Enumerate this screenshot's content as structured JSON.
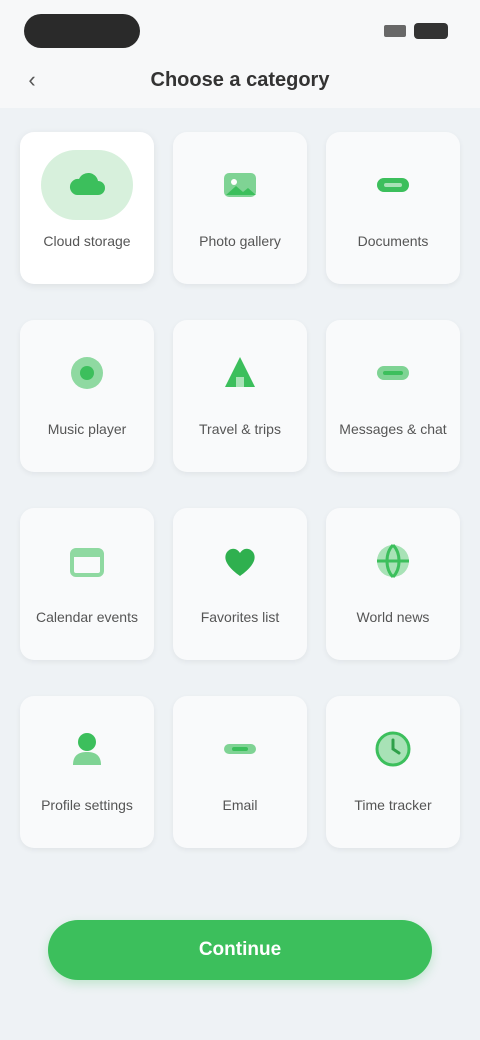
{
  "header": {
    "title": "Choose a category"
  },
  "categories": [
    {
      "label": "Cloud storage",
      "icon": "cloud-icon",
      "selected": true
    },
    {
      "label": "Photo gallery",
      "icon": "image-icon",
      "selected": false
    },
    {
      "label": "Documents",
      "icon": "document-icon",
      "selected": false
    },
    {
      "label": "Music player",
      "icon": "music-icon",
      "selected": false
    },
    {
      "label": "Travel & trips",
      "icon": "triangle-icon",
      "selected": false
    },
    {
      "label": "Messages & chat",
      "icon": "chat-icon",
      "selected": false
    },
    {
      "label": "Calendar events",
      "icon": "calendar-icon",
      "selected": false
    },
    {
      "label": "Favorites list",
      "icon": "heart-icon",
      "selected": false
    },
    {
      "label": "World news",
      "icon": "globe-icon",
      "selected": false
    },
    {
      "label": "Profile settings",
      "icon": "user-icon",
      "selected": false
    },
    {
      "label": "Email",
      "icon": "mail-icon",
      "selected": false
    },
    {
      "label": "Time tracker",
      "icon": "clock-icon",
      "selected": false
    }
  ],
  "footer": {
    "continue_label": "Continue"
  },
  "colors": {
    "accent": "#3cbf5c",
    "accent_light": "#d7f0dc",
    "background": "#eef2f5"
  }
}
